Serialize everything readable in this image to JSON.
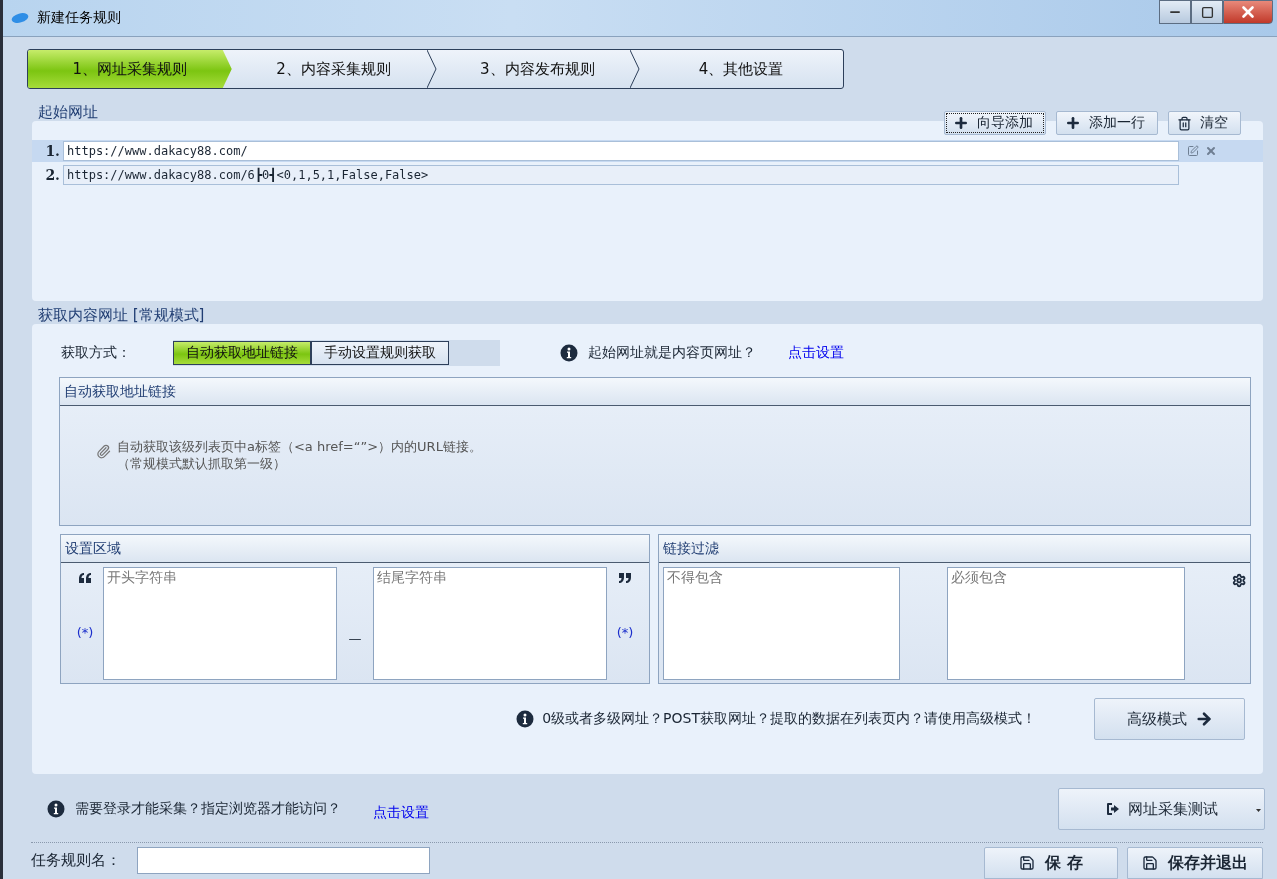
{
  "window": {
    "title": "新建任务规则"
  },
  "steps": [
    {
      "label": "1、网址采集规则",
      "selected": true
    },
    {
      "label": "2、内容采集规则",
      "selected": false
    },
    {
      "label": "3、内容发布规则",
      "selected": false
    },
    {
      "label": "4、其他设置",
      "selected": false
    }
  ],
  "start_urls": {
    "title": "起始网址",
    "buttons": [
      {
        "label": "向导添加",
        "kind": "add",
        "focused": true
      },
      {
        "label": "添加一行",
        "kind": "add",
        "focused": false
      },
      {
        "label": "清空",
        "kind": "clear",
        "focused": false
      }
    ],
    "rows": [
      {
        "number": "1.",
        "value": "https://www.dakacy88.com/",
        "selected": true
      },
      {
        "number": "2.",
        "value": "https://www.dakacy88.com/6┣0┫<0,1,5,1,False,False>",
        "selected": false
      }
    ]
  },
  "content_urls": {
    "title": "获取内容网址 [常规模式]",
    "method_label": "获取方式：",
    "methods": [
      {
        "label": "自动获取地址链接",
        "selected": true
      },
      {
        "label": "手动设置规则获取",
        "selected": false
      }
    ],
    "hint": "起始网址就是内容页网址？",
    "hint_link": "点击设置",
    "auto_panel": {
      "title": "自动获取地址链接",
      "lines": [
        "自动获取该级列表页中a标签（<a href=“”>）内的URL链接。",
        "（常规模式默认抓取第一级）"
      ]
    },
    "region": {
      "title": "设置区域",
      "start_placeholder": "开头字符串",
      "end_placeholder": "结尾字符串",
      "wildcard_left": "(*)",
      "separator": "—",
      "wildcard_right": "(*)"
    },
    "filter": {
      "title": "链接过滤",
      "exclude_placeholder": "不得包含",
      "include_placeholder": "必须包含"
    },
    "advanced_hint": "0级或者多级网址？POST获取网址？提取的数据在列表页内？请使用高级模式！",
    "advanced_button": "高级模式"
  },
  "footer": {
    "login_hint": "需要登录才能采集？指定浏览器才能访问？",
    "login_link": "点击设置",
    "test_button": "网址采集测试",
    "name_label": "任务规则名：",
    "save_buttons": [
      "保 存",
      "保存并退出"
    ]
  }
}
